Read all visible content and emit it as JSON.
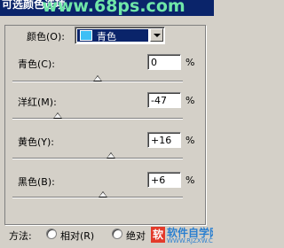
{
  "window": {
    "title": "可选颜色选项",
    "watermark": "www.68ps.com"
  },
  "colors": {
    "label": "颜色(O):",
    "selected": "青色",
    "swatch": "#3fbff5"
  },
  "sliders": [
    {
      "label": "青色(C):",
      "value": "0",
      "unit": "%",
      "level": 0
    },
    {
      "label": "洋红(M):",
      "value": "-47",
      "unit": "%",
      "level": -47
    },
    {
      "label": "黄色(Y):",
      "value": "+16",
      "unit": "%",
      "level": 16
    },
    {
      "label": "黑色(B):",
      "value": "+6",
      "unit": "%",
      "level": 6
    }
  ],
  "method": {
    "label": "方法:",
    "relative": "相对(R)",
    "absolute": "绝对"
  },
  "logo": {
    "mark": "软",
    "name": "软件自学网",
    "url": "WWW.RJZXW.COM"
  }
}
